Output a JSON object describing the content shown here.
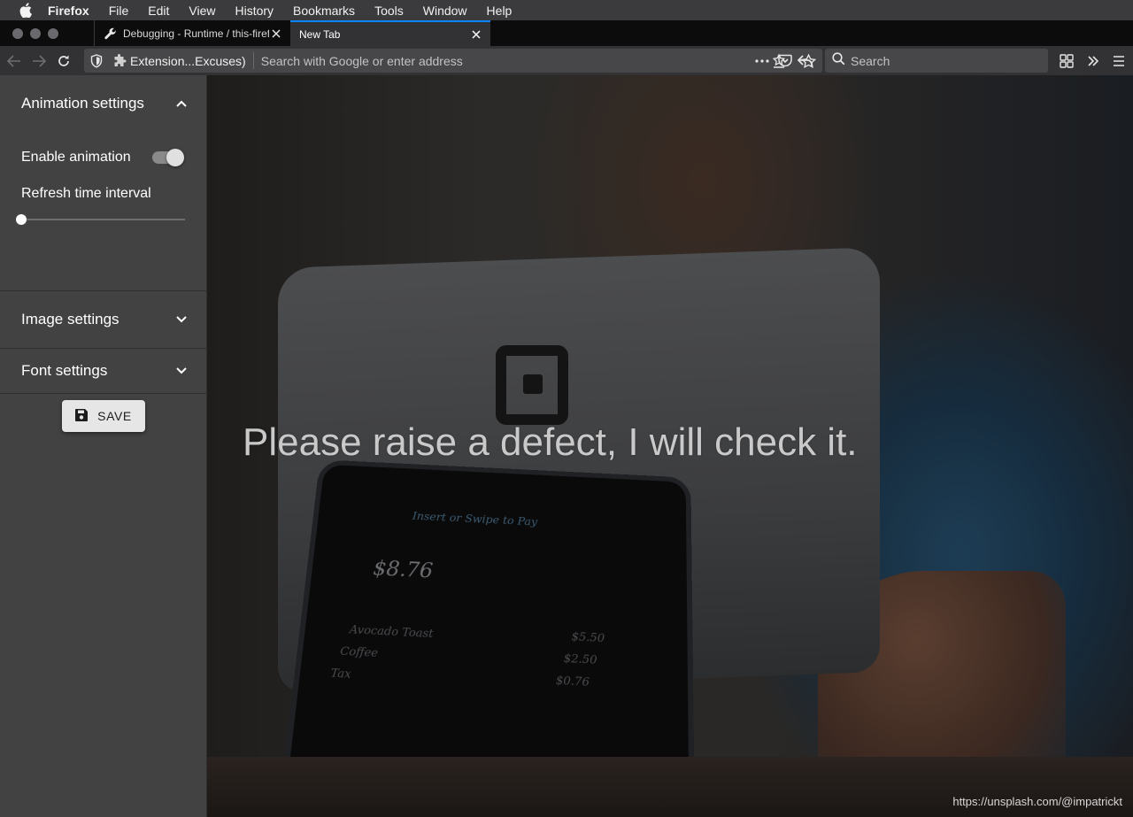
{
  "menubar": {
    "app_name": "Firefox",
    "items": [
      "File",
      "Edit",
      "View",
      "History",
      "Bookmarks",
      "Tools",
      "Window",
      "Help"
    ]
  },
  "tabs": [
    {
      "label": "Debugging - Runtime / this-firefox",
      "icon": "wrench-icon",
      "active": false
    },
    {
      "label": "New Tab",
      "icon": "",
      "active": true
    }
  ],
  "toolbar": {
    "extension_chip": "Extension...Excuses)",
    "url_placeholder": "Search with Google or enter address",
    "search_placeholder": "Search"
  },
  "sidebar": {
    "animation": {
      "title": "Animation settings",
      "expanded": true,
      "enable_label": "Enable animation",
      "enable_value": true,
      "interval_label": "Refresh time interval",
      "interval_value": 0
    },
    "image": {
      "title": "Image settings",
      "expanded": false
    },
    "font": {
      "title": "Font settings",
      "expanded": false
    },
    "save_label": "SAVE"
  },
  "hero": {
    "message": "Please raise a defect, I will check it.",
    "credit": "https://unsplash.com/@impatrickt",
    "screen": {
      "prompt": "Insert or Swipe to Pay",
      "total": "$8.76",
      "lines": [
        {
          "item": "Avocado Toast",
          "price": "$5.50"
        },
        {
          "item": "Coffee",
          "price": "$2.50"
        },
        {
          "item": "Tax",
          "price": "$0.76"
        }
      ]
    }
  },
  "colors": {
    "accent": "#0a84ff",
    "sidebar_bg": "#424242",
    "toolbar_bg": "#323234"
  }
}
